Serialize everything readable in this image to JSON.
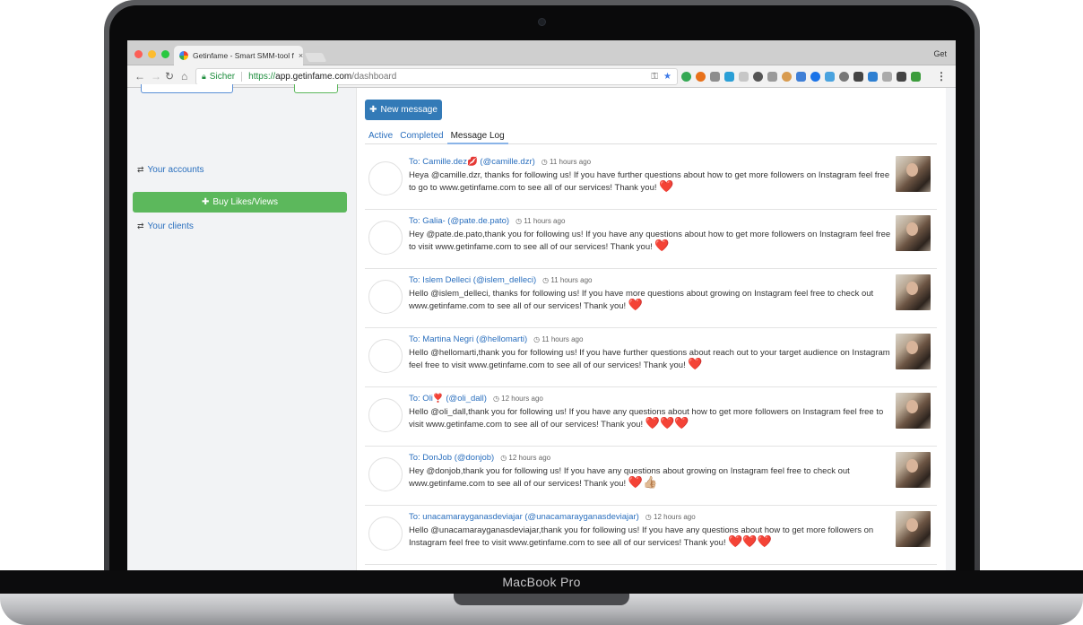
{
  "device": {
    "label": "MacBook Pro"
  },
  "browser": {
    "tab_title": "Getinfame - Smart SMM-tool f",
    "tab_close": "×",
    "profile_text": "Get",
    "secure_label": "Sicher",
    "url_scheme": "https://",
    "url_host": "app.getinfame.com",
    "url_path": "/dashboard"
  },
  "sidebar": {
    "accounts_link": "Your accounts",
    "buy_button": "Buy Likes/Views",
    "clients_link": "Your clients"
  },
  "main": {
    "new_message_button": "New message",
    "tabs": [
      {
        "label": "Active"
      },
      {
        "label": "Completed"
      },
      {
        "label": "Message Log"
      }
    ],
    "messages": [
      {
        "recipient": "To: Camille.dez💋 (@camille.dzr)",
        "time": "11 hours ago",
        "text": "Heya @camille.dzr, thanks for following us! If you have further questions about how to get more followers on Instagram feel free to go to www.getinfame.com to see all of our services! Thank you!",
        "emoji": "❤️"
      },
      {
        "recipient": "To: Galia- (@pate.de.pato)",
        "time": "11 hours ago",
        "text": "Hey @pate.de.pato,thank you for following us! If you have any questions about how to get more followers on Instagram feel free to visit www.getinfame.com to see all of our services! Thank you!",
        "emoji": "❤️"
      },
      {
        "recipient": "To: Islem Delleci (@islem_delleci)",
        "time": "11 hours ago",
        "text": "Hello @islem_delleci, thanks for following us! If you have more questions about growing on Instagram feel free to check out www.getinfame.com to see all of our services! Thank you!",
        "emoji": "❤️"
      },
      {
        "recipient": "To: Martina Negri (@hellomarti)",
        "time": "11 hours ago",
        "text": "Hello @hellomarti,thank you for following us! If you have further questions about reach out to your target audience on Instagram feel free to visit www.getinfame.com to see all of our services! Thank you!",
        "emoji": "❤️"
      },
      {
        "recipient": "To: Oli❣️ (@oli_dall)",
        "time": "12 hours ago",
        "text": "Hello @oli_dall,thank you for following us! If you have any questions about how to get more followers on Instagram feel free to visit www.getinfame.com to see all of our services! Thank you!",
        "emoji": "❤️❤️❤️"
      },
      {
        "recipient": "To: DonJob (@donjob)",
        "time": "12 hours ago",
        "text": "Hey @donjob,thank you for following us! If you have any questions about growing on Instagram feel free to check out www.getinfame.com to see all of our services! Thank you!",
        "emoji": "❤️👍🏼"
      },
      {
        "recipient": "To: unacamarayganasdeviajar (@unacamarayganasdeviajar)",
        "time": "12 hours ago",
        "text": "Hello @unacamarayganasdeviajar,thank you for following us! If you have any questions about how to get more followers on Instagram feel free to visit www.getinfame.com to see all of our services! Thank you!",
        "emoji": "❤️❤️❤️"
      }
    ]
  },
  "colors": {
    "primary": "#337ab7",
    "success": "#5cb85c",
    "link": "#2a6fbe"
  }
}
